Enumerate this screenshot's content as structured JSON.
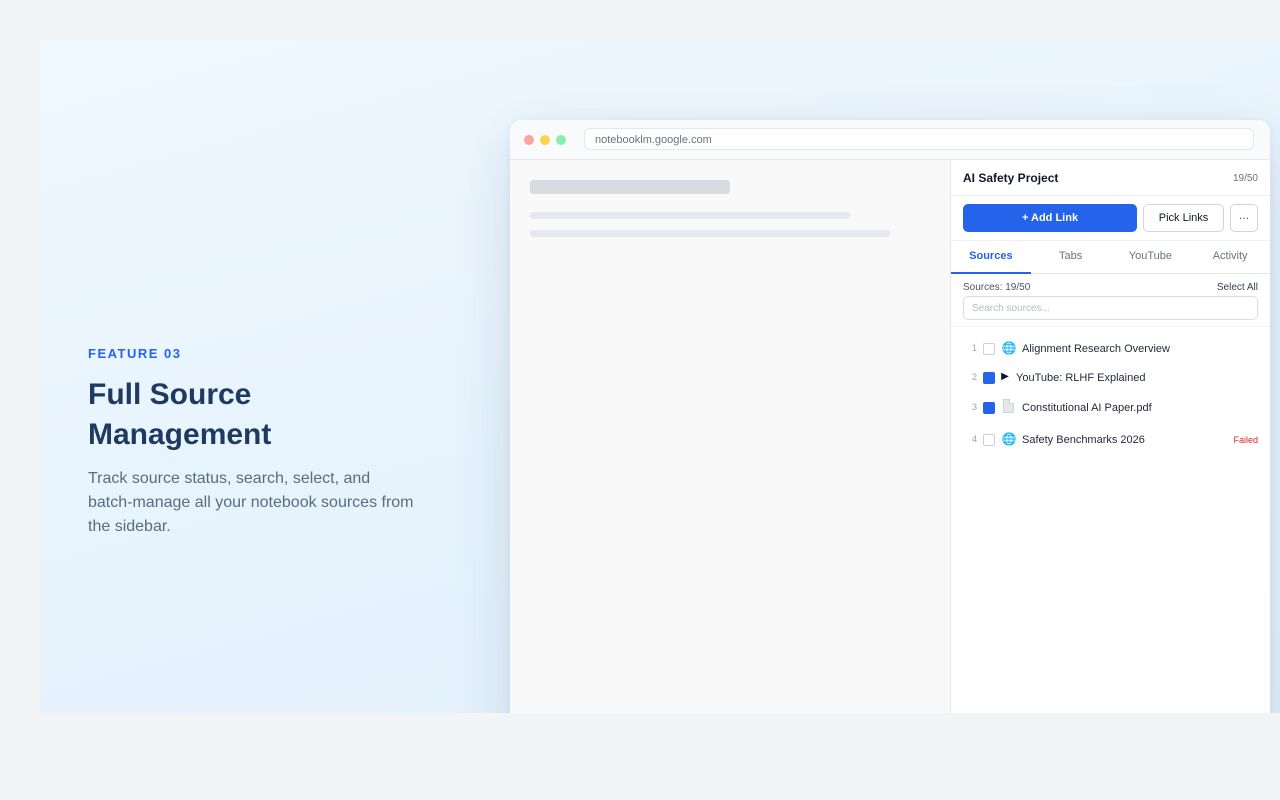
{
  "hero": {
    "eyebrow": "FEATURE 03",
    "headline_line1": "Full Source",
    "headline_line2": "Management",
    "description": "Track source status, search, select, and batch-manage all your notebook sources from the sidebar."
  },
  "browser": {
    "url": "notebooklm.google.com"
  },
  "sidebar": {
    "title": "AI Safety Project",
    "count": "19/50",
    "add_link_label": "+ Add Link",
    "pick_links_label": "Pick Links",
    "more_label": "···",
    "tabs": [
      {
        "label": "Sources",
        "active": true
      },
      {
        "label": "Tabs",
        "active": false
      },
      {
        "label": "YouTube",
        "active": false
      },
      {
        "label": "Activity",
        "active": false
      }
    ],
    "sources_label": "Sources: 19/50",
    "select_all_label": "Select All",
    "search_placeholder": "Search sources...",
    "sources": [
      {
        "index": "1",
        "checked": false,
        "icon": "globe-icon",
        "name": "Alignment Research Overview",
        "status": ""
      },
      {
        "index": "2",
        "checked": true,
        "icon": "play-icon",
        "name": "YouTube: RLHF Explained",
        "status": ""
      },
      {
        "index": "3",
        "checked": true,
        "icon": "pdf-file-icon",
        "name": "Constitutional AI Paper.pdf",
        "status": ""
      },
      {
        "index": "4",
        "checked": false,
        "icon": "globe-icon",
        "name": "Safety Benchmarks 2026",
        "status": "Failed"
      }
    ]
  },
  "colors": {
    "accent": "#2563eb",
    "headline": "#1e3a5f",
    "failed": "#dc2626"
  }
}
